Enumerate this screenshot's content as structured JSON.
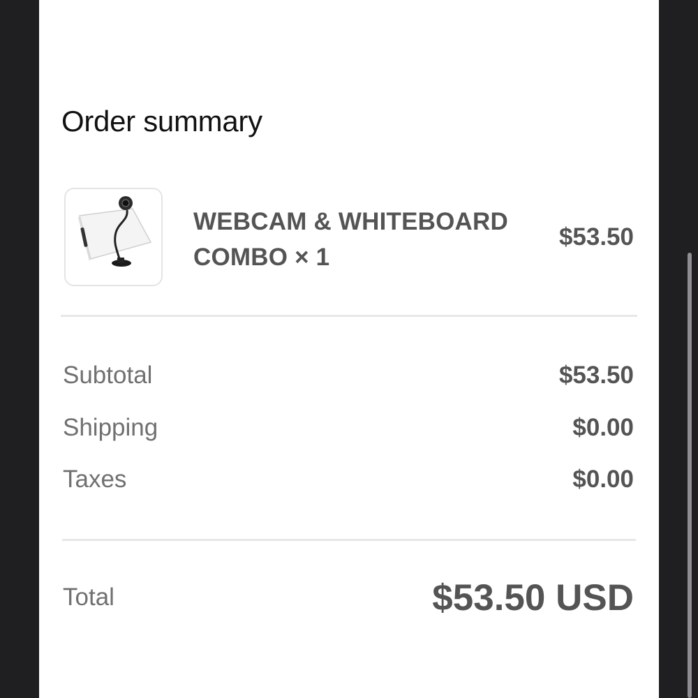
{
  "order_summary": {
    "title": "Order summary",
    "line_items": [
      {
        "name": "WEBCAM & WHITEBOARD COMBO × 1",
        "price": "$53.50",
        "image_icon": "webcam-whiteboard-product-image"
      }
    ],
    "subtotal": {
      "label": "Subtotal",
      "value": "$53.50"
    },
    "shipping": {
      "label": "Shipping",
      "value": "$0.00"
    },
    "taxes": {
      "label": "Taxes",
      "value": "$0.00"
    },
    "total": {
      "label": "Total",
      "value": "$53.50 USD"
    }
  },
  "colors": {
    "background_outer": "#1f1f21",
    "panel": "#ffffff",
    "divider": "#e7e7e7",
    "label_text": "#707070",
    "value_text": "#545454",
    "title_text": "#111111"
  }
}
